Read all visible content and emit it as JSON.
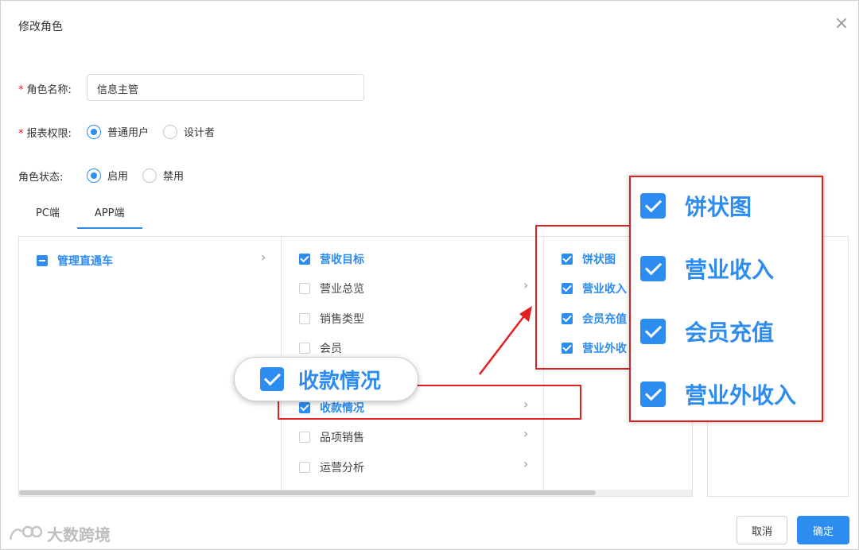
{
  "dialog": {
    "title": "修改角色",
    "close_glyph": "×"
  },
  "form": {
    "role_name": {
      "required_mark": "*",
      "label": "角色名称:",
      "value": "信息主管"
    },
    "report_permission": {
      "required_mark": "*",
      "label": "报表权限:",
      "options": [
        {
          "label": "普通用户",
          "selected": true
        },
        {
          "label": "设计者",
          "selected": false
        }
      ]
    },
    "role_status": {
      "label": "角色状态:",
      "options": [
        {
          "label": "启用",
          "selected": true
        },
        {
          "label": "禁用",
          "selected": false
        }
      ]
    }
  },
  "tabs": [
    {
      "label": "PC端",
      "active": false
    },
    {
      "label": "APP端",
      "active": true
    }
  ],
  "tree": {
    "col1": [
      {
        "label": "管理直通车",
        "state": "indeterminate",
        "has_children": true
      }
    ],
    "col2": [
      {
        "label": "营收目标",
        "state": "checked",
        "has_children": false
      },
      {
        "label": "营业总览",
        "state": "unchecked",
        "has_children": true
      },
      {
        "label": "销售类型",
        "state": "unchecked",
        "has_children": false
      },
      {
        "label": "会员",
        "state": "unchecked",
        "has_children": false
      },
      {
        "label": "收款情况",
        "state": "checked",
        "has_children": true
      },
      {
        "label": "品项销售",
        "state": "unchecked",
        "has_children": true
      },
      {
        "label": "运营分析",
        "state": "unchecked",
        "has_children": true
      }
    ],
    "col3": [
      {
        "label": "饼状图",
        "state": "checked"
      },
      {
        "label": "营业收入",
        "state": "checked"
      },
      {
        "label": "会员充值",
        "state": "checked"
      },
      {
        "label": "营业外收",
        "state": "checked"
      }
    ]
  },
  "callouts": {
    "bubble_label": "收款情况",
    "zoom_items": [
      "饼状图",
      "营业收入",
      "会员充值",
      "营业外收入"
    ],
    "highlight_color": "#e02020"
  },
  "footer": {
    "cancel_label": "取消",
    "ok_label": "确定"
  },
  "watermark": {
    "text": "大数跨境"
  },
  "colors": {
    "accent": "#2d8cf0",
    "required": "#e02020"
  }
}
